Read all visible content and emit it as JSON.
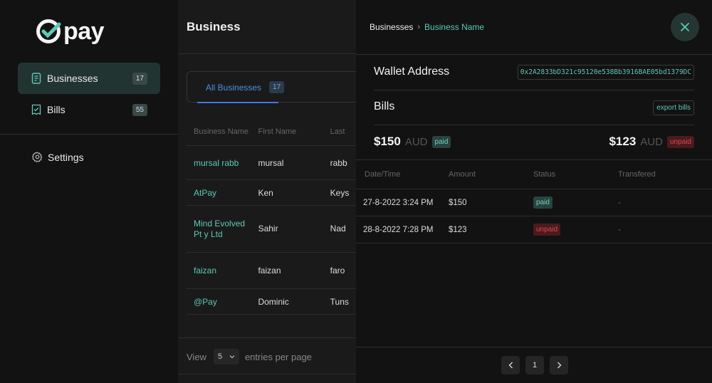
{
  "brand": {
    "name": "pay",
    "accent": "#5ec8b5"
  },
  "sidebar": {
    "items": [
      {
        "label": "Businesses",
        "count": "17",
        "icon": "document-icon"
      },
      {
        "label": "Bills",
        "count": "55",
        "icon": "receipt-icon"
      }
    ],
    "settings_label": "Settings"
  },
  "main": {
    "title": "Business",
    "tab": {
      "label": "All Businesses",
      "count": "17"
    },
    "table": {
      "headers": [
        "Business Name",
        "First Name",
        "Last"
      ],
      "rows": [
        {
          "business": "mursal rabb",
          "first": "mursal",
          "last": "rabb"
        },
        {
          "business": "AtPay",
          "first": "Ken",
          "last": "Keys"
        },
        {
          "business": "Mind Evolved Pt y Ltd",
          "first": "Sahir",
          "last": "Nad"
        },
        {
          "business": "faizan",
          "first": "faizan",
          "last": "faro"
        },
        {
          "business": "@Pay",
          "first": "Dominic",
          "last": "Tuns"
        }
      ]
    },
    "footer": {
      "view_label": "View",
      "page_size": "5",
      "entries_label": "entries per page"
    }
  },
  "drawer": {
    "breadcrumb": [
      "Businesses",
      "Business Name"
    ],
    "wallet_label": "Wallet Address",
    "wallet_value": "0x2A2833bD321c95120e538Bb3916BAE05bd1379DC",
    "bills_label": "Bills",
    "export_label": "export bills",
    "summary": {
      "paid": {
        "value": "$150",
        "currency": "AUD",
        "status": "paid"
      },
      "unpaid": {
        "value": "$123",
        "currency": "AUD",
        "status": "unpaid"
      }
    },
    "bills_table": {
      "headers": [
        "Date/Time",
        "Amount",
        "Status",
        "Transfered"
      ],
      "rows": [
        {
          "datetime": "27-8-2022 3:24 PM",
          "amount": "$150",
          "status": "paid",
          "transferred": "-"
        },
        {
          "datetime": "28-8-2022 7:28 PM",
          "amount": "$123",
          "status": "unpaid",
          "transferred": "-"
        }
      ]
    },
    "pagination": {
      "current": "1"
    }
  }
}
